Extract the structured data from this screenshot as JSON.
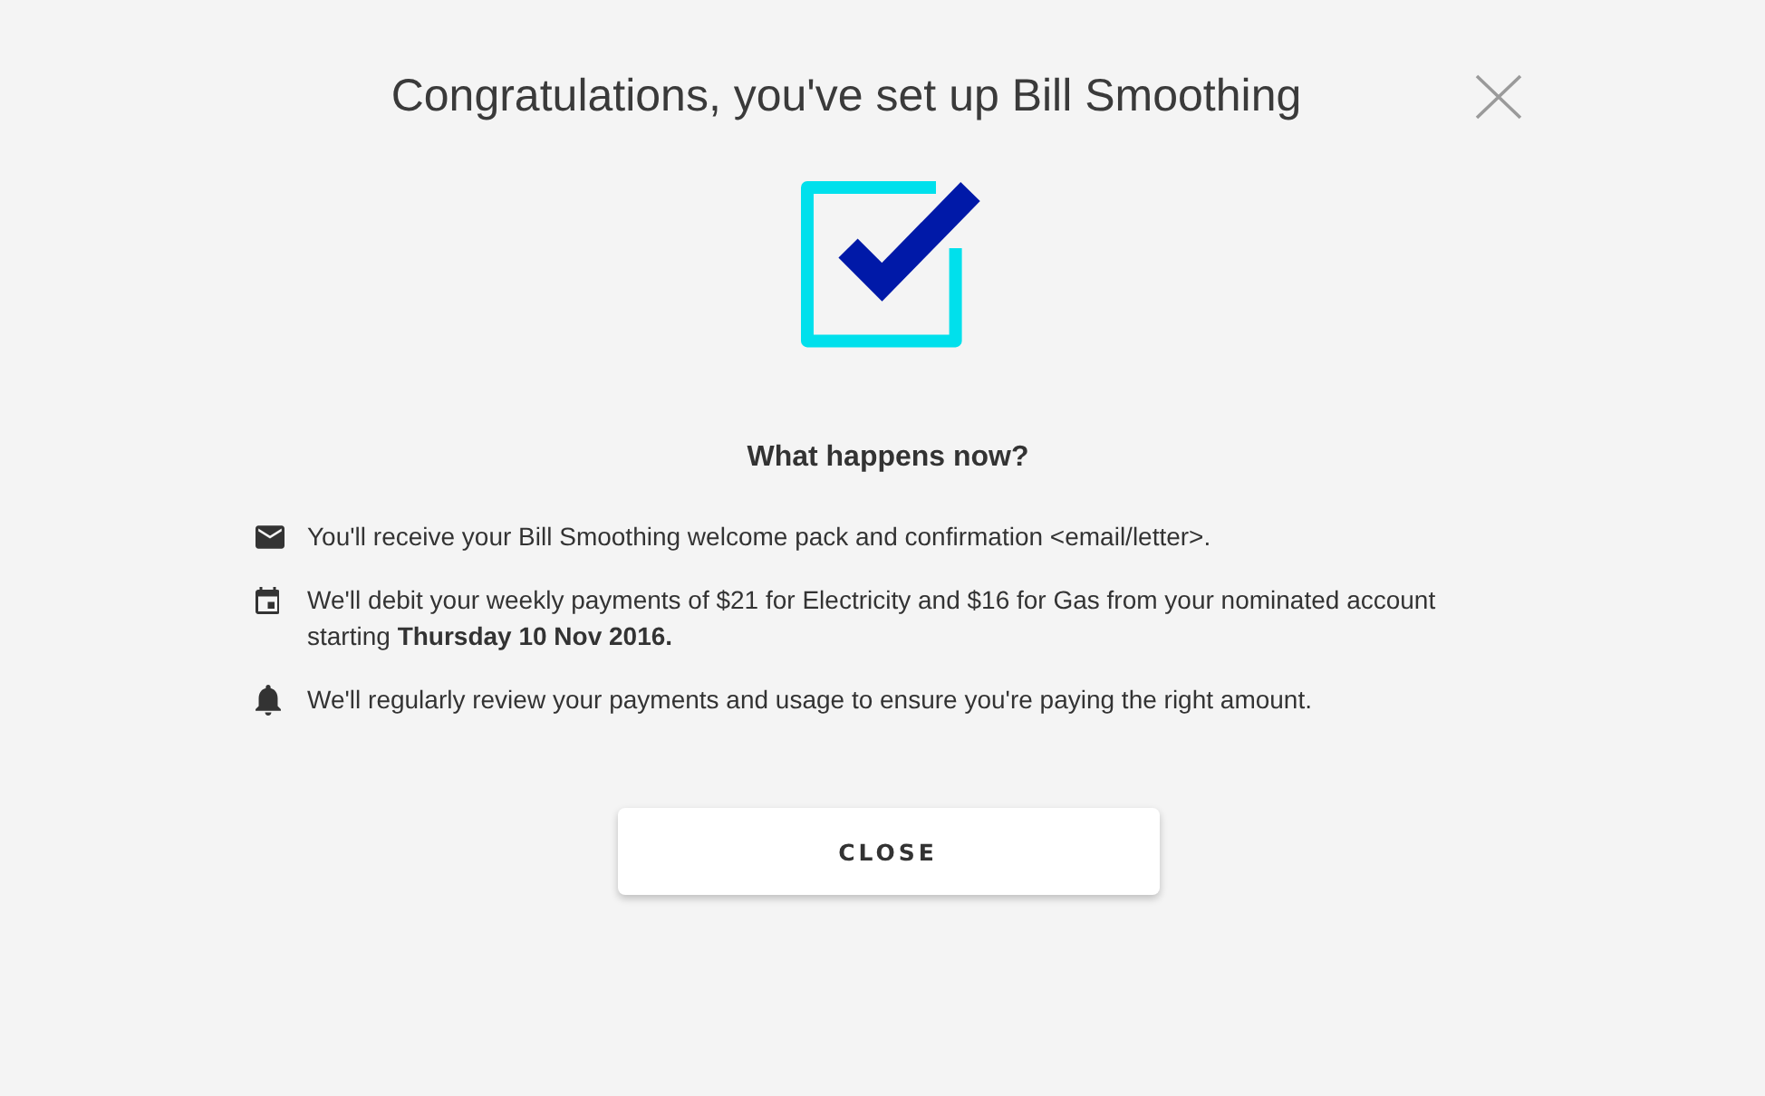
{
  "dialog": {
    "title": "Congratulations, you've set up Bill Smoothing"
  },
  "section": {
    "heading": "What happens now?",
    "steps": [
      "You'll receive your Bill Smoothing welcome pack and confirmation <email/letter>.",
      "We'll debit your weekly payments of $21 for Electricity and $16 for Gas from your nominated account starting **Thursday 10 Nov 2016.**",
      "We'll regularly review your payments and usage to ensure you're paying the right amount."
    ]
  },
  "button": {
    "label": "CLOSE"
  }
}
